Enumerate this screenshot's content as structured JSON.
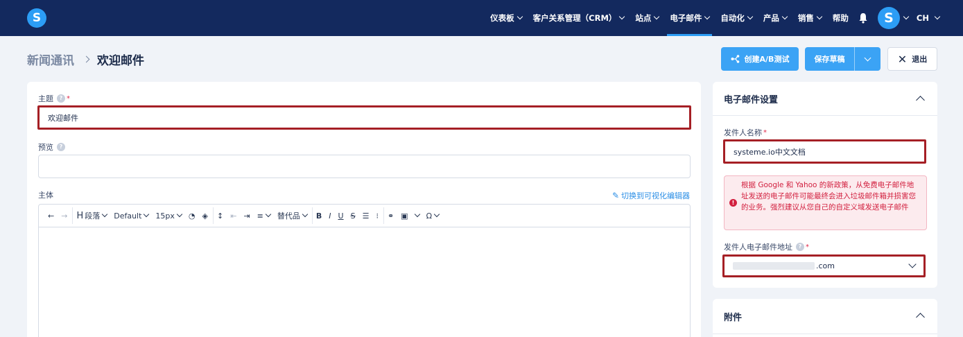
{
  "nav": {
    "logo_letter": "S",
    "items": [
      {
        "label": "仪表板",
        "chevron": true
      },
      {
        "label": "客户关系管理（CRM）",
        "chevron": true
      },
      {
        "label": "站点",
        "chevron": true
      },
      {
        "label": "电子邮件",
        "chevron": true,
        "active": true
      },
      {
        "label": "自动化",
        "chevron": true
      },
      {
        "label": "产品",
        "chevron": true
      },
      {
        "label": "销售",
        "chevron": true
      },
      {
        "label": "帮助",
        "chevron": false
      }
    ],
    "avatar_letter": "S",
    "language": "CH"
  },
  "breadcrumb": {
    "parent": "新闻通讯",
    "current": "欢迎邮件"
  },
  "actions": {
    "ab_test": "创建A/B测试",
    "save_draft": "保存草稿",
    "exit": "退出"
  },
  "form": {
    "subject_label": "主题",
    "subject_value": "欢迎邮件",
    "preview_label": "预览",
    "preview_value": "",
    "body_label": "主体",
    "switch_editor": "切换到可视化编辑器",
    "toolbar": {
      "paragraph": "段落",
      "font": "Default",
      "size": "15px",
      "alternatives": "替代品"
    }
  },
  "settings": {
    "title": "电子邮件设置",
    "sender_name_label": "发件人名称",
    "sender_name_value": "systeme.io中文文档",
    "alert": "根据 Google 和 Yahoo 的新政策，从免费电子邮件地址发送的电子邮件可能最终会进入垃圾邮件箱并损害您的业务。强烈建议从您自己的自定义域发送电子邮件",
    "sender_email_label": "发件人电子邮件地址",
    "sender_email_suffix": ".com"
  },
  "attachments": {
    "title": "附件"
  },
  "colors": {
    "nav_bg": "#13295e",
    "accent": "#3ba3f5",
    "highlight": "#a51f25",
    "alert_text": "#d2203f"
  }
}
